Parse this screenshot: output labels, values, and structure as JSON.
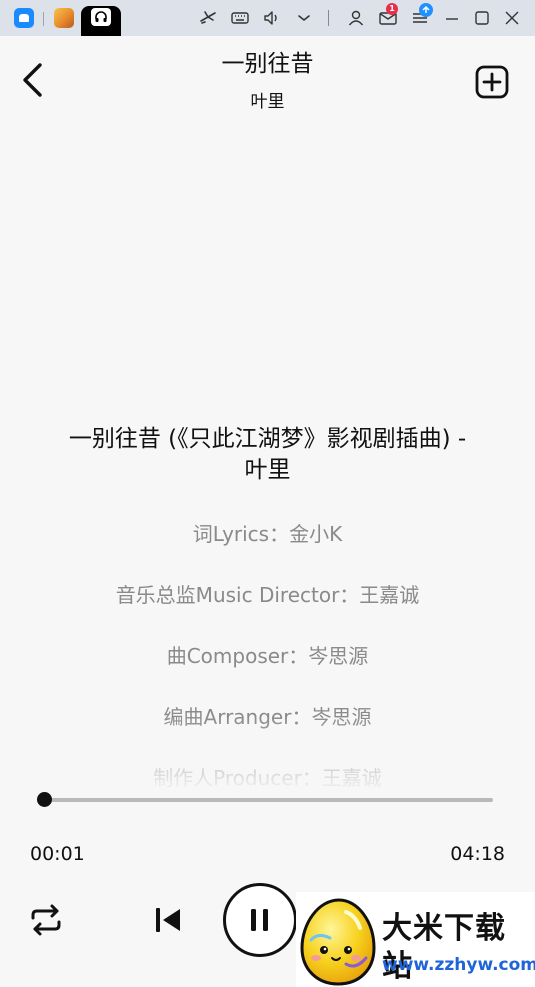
{
  "header": {
    "title": "一别往昔",
    "artist": "叶里"
  },
  "lyrics": {
    "heading_line1": "一别往昔 (《只此江湖梦》影视剧插曲) -",
    "heading_line2": "叶里",
    "lines": [
      "词Lyrics：金小K",
      "音乐总监Music Director：王嘉诚",
      "曲Composer：岑思源",
      "编曲Arranger：岑思源",
      "制作人Producer：王嘉诚"
    ]
  },
  "player": {
    "elapsed": "00:01",
    "total": "04:18",
    "progress_fraction": 0.004
  },
  "top_bar": {
    "mail_badge_count": "1"
  },
  "watermark": {
    "brand": "大米下载站",
    "url": "www.zzhyw.com"
  },
  "colors": {
    "background": "#f7f7f7",
    "primary_text": "#111111",
    "secondary_text": "#8a8a8a",
    "progress_track": "#b9b9b9",
    "watermark_url": "#1f64d8",
    "badge_red": "#e5304a",
    "badge_blue": "#1e90ff"
  },
  "icons": {
    "back": "chevron-left-icon",
    "add": "add-square-icon",
    "repeat": "repeat-icon",
    "previous": "skip-previous-icon",
    "pause": "pause-icon"
  }
}
